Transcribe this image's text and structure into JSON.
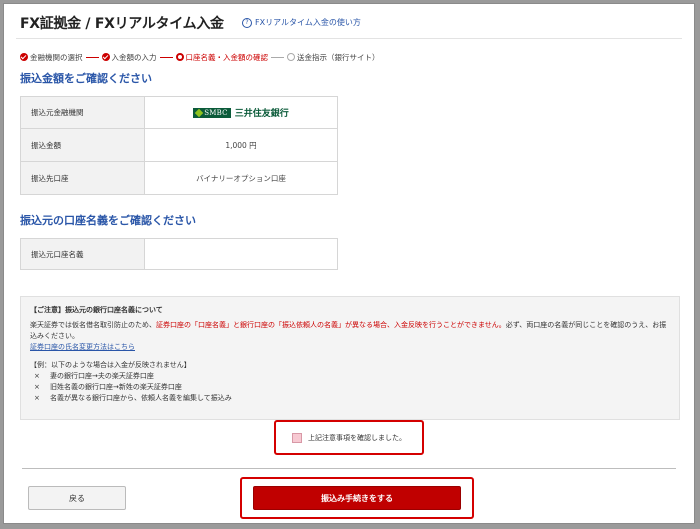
{
  "header": {
    "title": "FX証拠金 / FXリアルタイム入金",
    "help_link": "FXリアルタイム入金の使い方",
    "help_icon": "question-circle-icon"
  },
  "steps": [
    {
      "label": "金融機関の選択",
      "state": "done"
    },
    {
      "label": "入金額の入力",
      "state": "done"
    },
    {
      "label": "口座名義・入金額の確認",
      "state": "current"
    },
    {
      "label": "送金指示（銀行サイト）",
      "state": "pending"
    }
  ],
  "transfer_section": {
    "heading": "振込金額をご確認ください",
    "rows": [
      {
        "label": "振込元金融機関",
        "value": "三井住友銀行",
        "logo_text": "SMBC"
      },
      {
        "label": "振込金額",
        "value": "1,000 円"
      },
      {
        "label": "振込先口座",
        "value": "バイナリーオプション口座"
      }
    ]
  },
  "account_section": {
    "heading": "振込元の口座名義をご確認ください",
    "rows": [
      {
        "label": "振込元口座名義",
        "value": ""
      }
    ]
  },
  "notice": {
    "title": "【ご注意】振込元の銀行口座名義について",
    "body_prefix": "楽天証券では仮名借名取引防止のため、",
    "body_red": "証券口座の「口座名義」と銀行口座の「振込依頼人の名義」が異なる場合、入金反映を行うことができません。",
    "body_suffix": "必ず、両口座の名義が同じことを確認のうえ、お振込みください。",
    "link": "証券口座の氏名変更方法はこちら",
    "examples_title": "【例：以下のような場合は入金が反映されません】",
    "examples": [
      "妻の銀行口座→夫の楽天証券口座",
      "旧姓名義の銀行口座→新姓の楽天証券口座",
      "名義が異なる銀行口座から、依頼人名義を編集して振込み"
    ],
    "example_marker": "×"
  },
  "confirm": {
    "label": "上記注意事項を確認しました。",
    "checked": false
  },
  "buttons": {
    "back": "戻る",
    "proceed": "振込み手続きをする"
  },
  "colors": {
    "accent_red": "#c00000",
    "heading_blue": "#2a56a8",
    "smbc_green": "#0b5b3a"
  }
}
